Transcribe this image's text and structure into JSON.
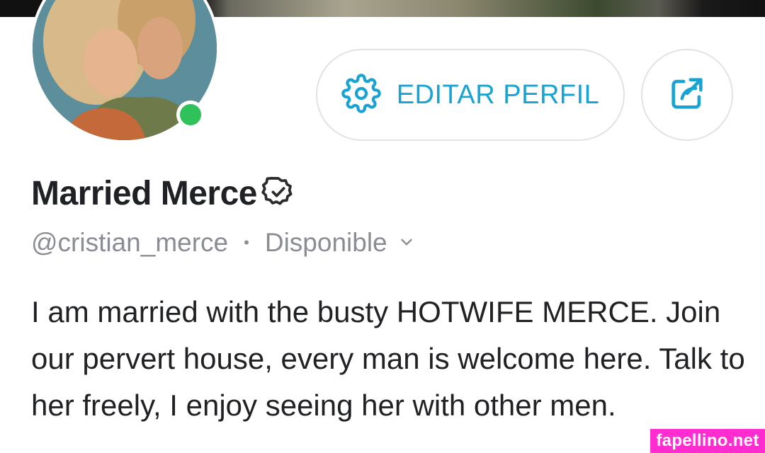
{
  "profile": {
    "display_name": "Married Merce",
    "handle": "@cristian_merce",
    "separator": "•",
    "status": "Disponible",
    "bio": "I am married with the busty HOTWIFE MERCE. Join our pervert house, every man is welcome here. Talk to her freely, I enjoy seeing her with other men.",
    "verified": true,
    "online": true
  },
  "actions": {
    "edit_label": "EDITAR PERFIL",
    "edit_icon": "gear-icon",
    "share_icon": "share-icon"
  },
  "colors": {
    "accent": "#18a3d3",
    "online": "#2fc15a",
    "muted_text": "#8a8d93",
    "watermark_bg": "#ff2ccf"
  },
  "watermark": "fapellino.net"
}
